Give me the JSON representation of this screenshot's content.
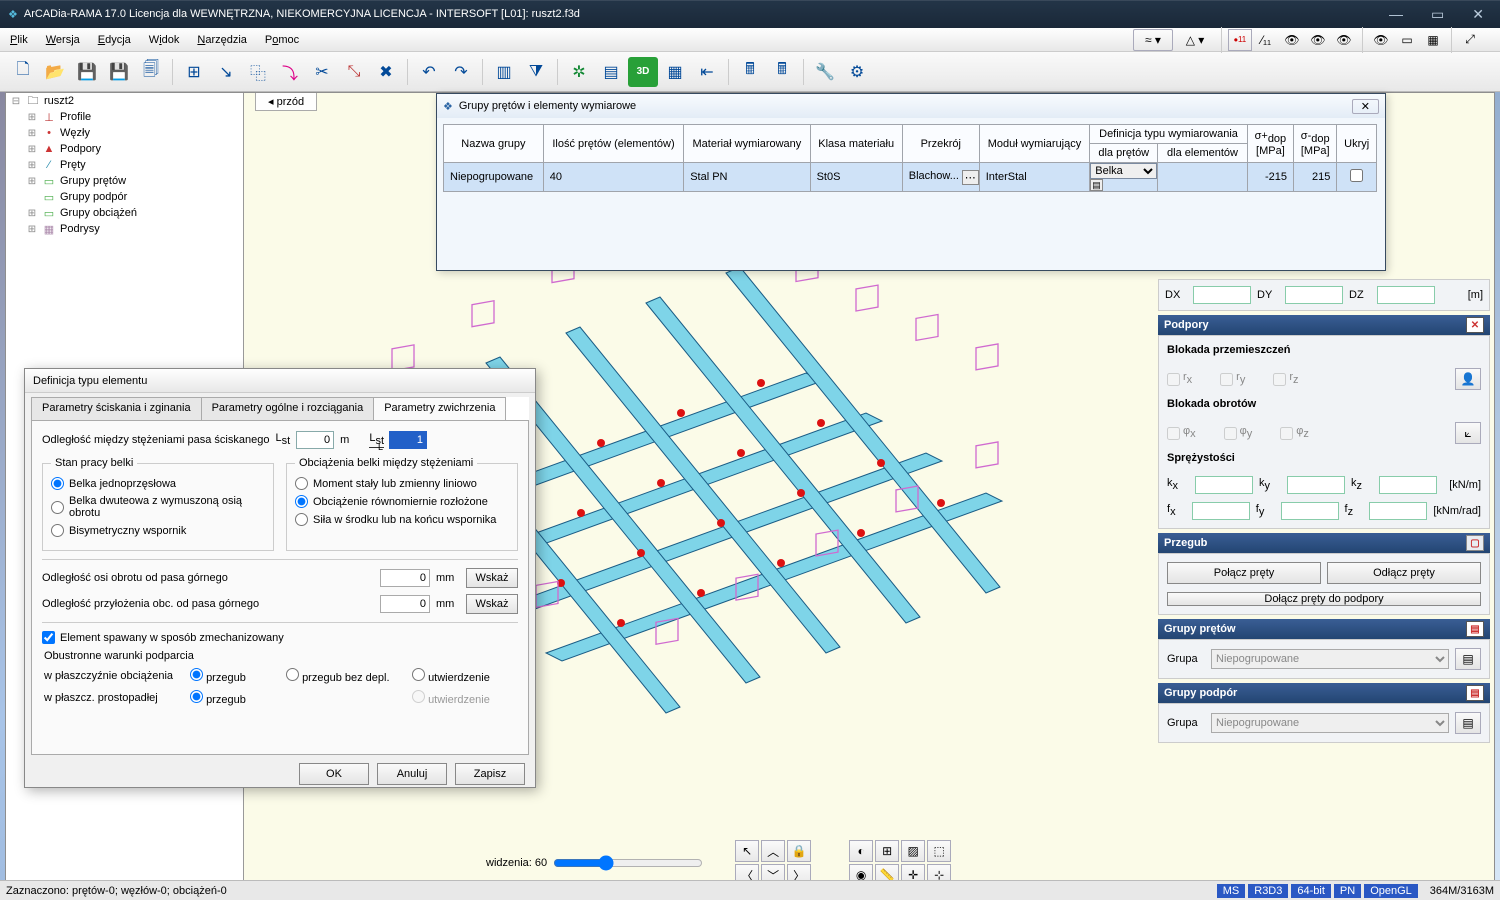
{
  "app": {
    "title": "ArCADia-RAMA 17.0 Licencja dla WEWNĘTRZNA, NIEKOMERCYJNA LICENCJA - INTERSOFT [L01]: ruszt2.f3d"
  },
  "menu": {
    "items": [
      "Plik",
      "Wersja",
      "Edycja",
      "Widok",
      "Narzędzia",
      "Pomoc"
    ]
  },
  "tree": {
    "root": "ruszt2",
    "items": [
      "Profile",
      "Węzły",
      "Podpory",
      "Pręty",
      "Grupy prętów",
      "Grupy podpór",
      "Grupy obciążeń",
      "Podrysy"
    ]
  },
  "view": {
    "tab": "przód"
  },
  "grp_win": {
    "title": "Grupy prętów i elementy wymiarowe",
    "headers": {
      "name": "Nazwa grupy",
      "count": "Ilość prętów (elementów)",
      "material": "Materiał wymiarowany",
      "class": "Klasa materiału",
      "section": "Przekrój",
      "module": "Moduł wymiarujący",
      "deftype": "Definicja typu wymiarowania",
      "def_rods": "dla prętów",
      "def_elem": "dla elementów",
      "sp": "σ+",
      "sm": "σ-",
      "dop": "dop",
      "mpa": "[MPa]",
      "hide": "Ukryj"
    },
    "row": {
      "name": "Niepogrupowane",
      "count": "40",
      "material": "Stal PN",
      "class": "St0S",
      "section": "Blachow...",
      "module": "InterStal",
      "def_rods": "Belka",
      "sp": "-215",
      "sm": "215"
    }
  },
  "dxdydz": {
    "dx": "DX",
    "dy": "DY",
    "dz": "DZ",
    "unit": "[m]"
  },
  "podpory": {
    "title": "Podpory",
    "block_p": "Blokada przemieszczeń",
    "block_r": "Blokada obrotów",
    "r": {
      "x": "r",
      "y": "r",
      "z": "r"
    },
    "phi": {
      "x": "φ",
      "y": "φ",
      "z": "φ"
    },
    "spr": "Sprężystości",
    "kx": "k",
    "ky": "k",
    "kz": "k",
    "fx": "f",
    "fy": "f",
    "fz": "f",
    "unit_k": "[kN/m]",
    "unit_f": "[kNm/rad]"
  },
  "przegub": {
    "title": "Przegub",
    "b1": "Połącz pręty",
    "b2": "Odłącz pręty",
    "b3": "Dołącz pręty do podpory"
  },
  "grp_pr": {
    "title": "Grupy prętów",
    "label": "Grupa",
    "value": "Niepogrupowane"
  },
  "grp_pd": {
    "title": "Grupy podpór",
    "label": "Grupa",
    "value": "Niepogrupowane"
  },
  "dlg": {
    "title": "Definicja typu elementu",
    "tabs": [
      "Parametry ściskania i zginania",
      "Parametry ogólne i rozciągania",
      "Parametry zwichrzenia"
    ],
    "row1": {
      "label": "Odległość między stężeniami pasa ściskanego",
      "lst": "L",
      "sub": "st",
      "v1": "0",
      "m": "m",
      "lstL": "L",
      "v2": "1"
    },
    "fs1": {
      "legend": "Stan pracy belki",
      "o1": "Belka jednoprzęsłowa",
      "o2": "Belka dwuteowa z wymuszoną osią obrotu",
      "o3": "Bisymetryczny wspornik"
    },
    "fs2": {
      "legend": "Obciążenia belki między stężeniami",
      "o1": "Moment stały lub zmienny liniowo",
      "o2": "Obciążenie równomiernie rozłożone",
      "o3": "Siła w środku lub na końcu wspornika"
    },
    "r2": {
      "l1": "Odległość osi obrotu od pasa górnego",
      "l2": "Odległość przyłożenia obc. od pasa górnego",
      "v1": "0",
      "v2": "0",
      "unit": "mm",
      "btn": "Wskaż"
    },
    "cb": "Element spawany w sposób zmechanizowany",
    "sup": {
      "legend": "Obustronne warunki podparcia",
      "r1": "w płaszczyźnie obciążenia",
      "r2": "w płaszcz. prostopadłej",
      "o1": "przegub",
      "o2": "przegub bez depl.",
      "o3": "utwierdzenie"
    },
    "buttons": {
      "ok": "OK",
      "cancel": "Anuluj",
      "save": "Zapisz"
    }
  },
  "status": {
    "left": "Zaznaczono: prętów-0; węzłów-0; obciążeń-0",
    "ms": "MS",
    "r3d3": "R3D3",
    "bit": "64-bit",
    "pn": "PN",
    "ogl": "OpenGL",
    "mem": "364M/3163M"
  },
  "vp": {
    "angle": "widzenia: 60"
  }
}
